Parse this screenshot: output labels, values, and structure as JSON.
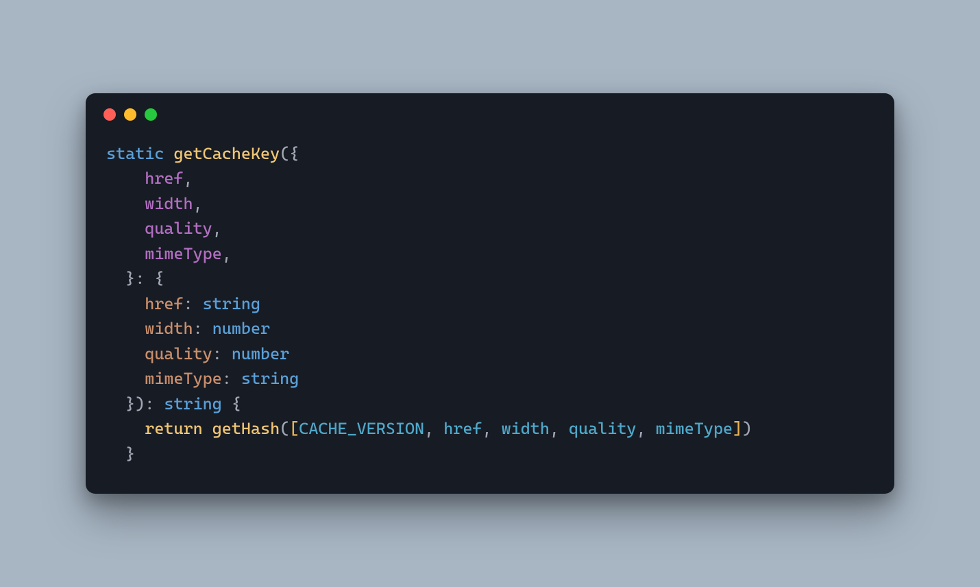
{
  "code": {
    "l1": {
      "static": "static",
      "fn": "getCacheKey",
      "open": "({"
    },
    "l2": {
      "p": "href",
      "c": ","
    },
    "l3": {
      "p": "width",
      "c": ","
    },
    "l4": {
      "p": "quality",
      "c": ","
    },
    "l5": {
      "p": "mimeType",
      "c": ","
    },
    "l6": {
      "t": "}: {"
    },
    "l7": {
      "k": "href",
      "colon": ": ",
      "ty": "string"
    },
    "l8": {
      "k": "width",
      "colon": ": ",
      "ty": "number"
    },
    "l9": {
      "k": "quality",
      "colon": ": ",
      "ty": "number"
    },
    "l10": {
      "k": "mimeType",
      "colon": ": ",
      "ty": "string"
    },
    "l11": {
      "t1": "}): ",
      "ty": "string",
      "t2": " {"
    },
    "l12": {
      "ret": "return",
      "sp": " ",
      "call": "getHash",
      "lb1": "(",
      "lb2": "[",
      "c1": "CACHE_VERSION",
      "s1": ", ",
      "i1": "href",
      "s2": ", ",
      "i2": "width",
      "s3": ", ",
      "i3": "quality",
      "s4": ", ",
      "i4": "mimeType",
      "rb2": "]",
      "rb1": ")"
    },
    "l13": {
      "t": "}"
    }
  }
}
